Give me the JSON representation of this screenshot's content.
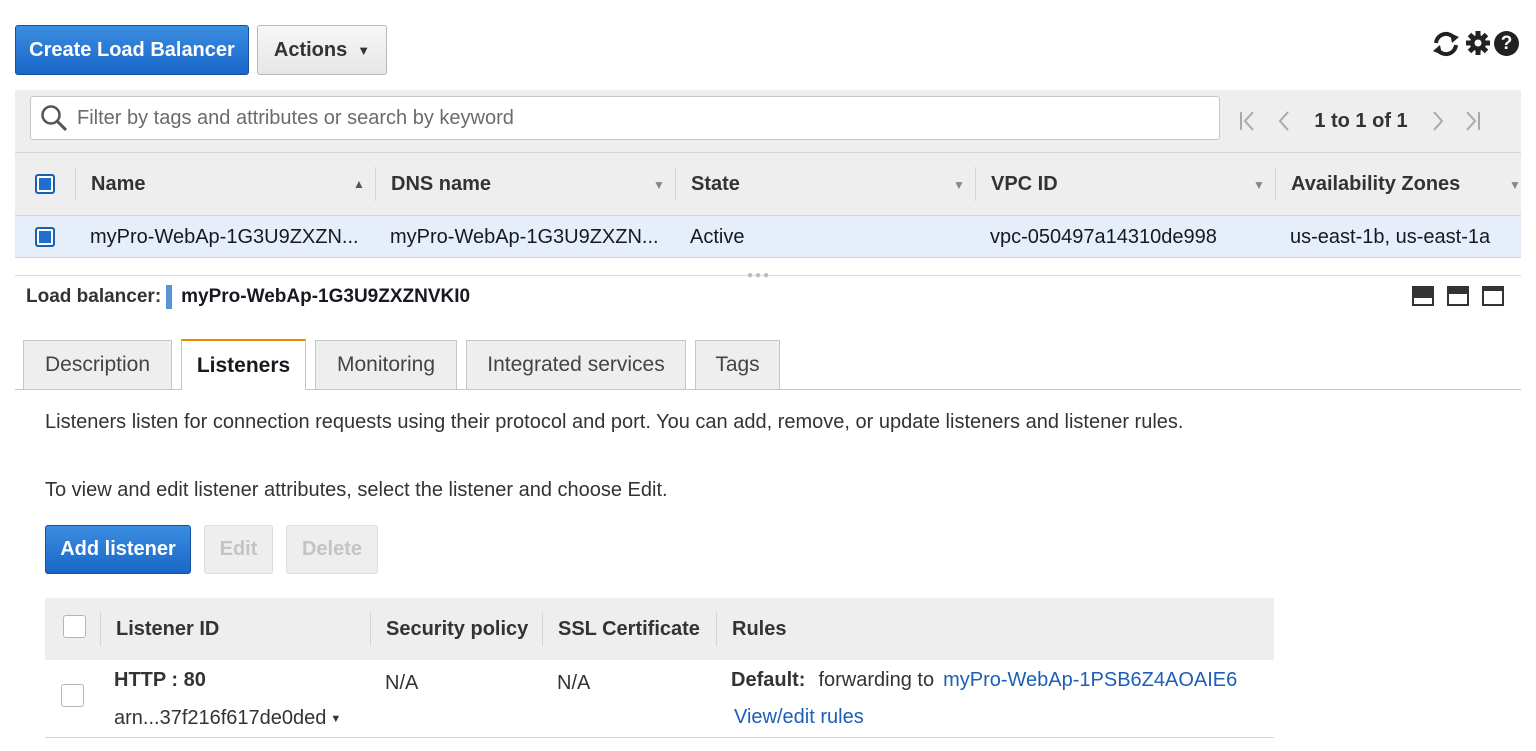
{
  "toolbar": {
    "create_label": "Create Load Balancer",
    "actions_label": "Actions"
  },
  "search": {
    "placeholder": "Filter by tags and attributes or search by keyword"
  },
  "pagination": {
    "range": "1 to 1 of 1"
  },
  "table": {
    "columns": [
      "Name",
      "DNS name",
      "State",
      "VPC ID",
      "Availability Zones"
    ],
    "rows": [
      {
        "name": "myPro-WebAp-1G3U9ZXZN...",
        "dns": "myPro-WebAp-1G3U9ZXZN...",
        "state": "Active",
        "vpc": "vpc-050497a14310de998",
        "azs": "us-east-1b, us-east-1a"
      }
    ]
  },
  "detail": {
    "label": "Load balancer:",
    "name": "myPro-WebAp-1G3U9ZXZNVKI0"
  },
  "tabs": [
    "Description",
    "Listeners",
    "Monitoring",
    "Integrated services",
    "Tags"
  ],
  "listeners": {
    "intro": "Listeners listen for connection requests using their protocol and port. You can add, remove, or update listeners and listener rules.",
    "hint": "To view and edit listener attributes, select the listener and choose Edit.",
    "add_label": "Add listener",
    "edit_label": "Edit",
    "delete_label": "Delete",
    "columns": [
      "Listener ID",
      "Security policy",
      "SSL Certificate",
      "Rules"
    ],
    "rows": [
      {
        "protocol_port": "HTTP : 80",
        "arn": "arn...37f216f617de0ded",
        "security_policy": "N/A",
        "ssl_certificate": "N/A",
        "default_label": "Default:",
        "forwarding_text": "forwarding to",
        "target": "myPro-WebAp-1PSB6Z4AOAIE6",
        "rules_link": "View/edit rules"
      }
    ]
  },
  "colors": {
    "primary": "#1f6fd1",
    "tab_accent": "#e88b00",
    "link": "#1c5fb8",
    "selected_row": "#e6eefa"
  },
  "icons": [
    "refresh-icon",
    "settings-gear-icon",
    "help-icon",
    "search-icon",
    "first-page-icon",
    "prev-page-icon",
    "next-page-icon",
    "last-page-icon"
  ]
}
